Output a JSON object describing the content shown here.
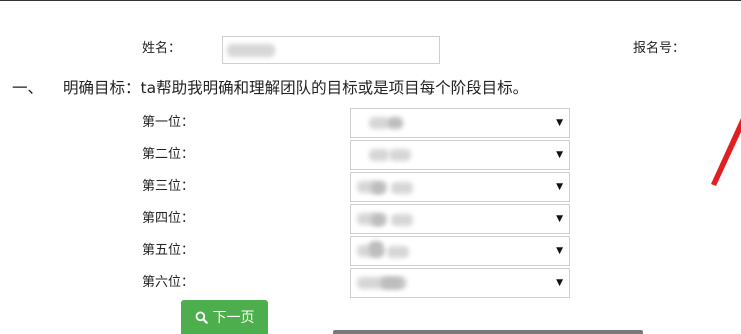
{
  "form": {
    "name_label": "姓名：",
    "reg_label": "报名号：",
    "question_number": "一、",
    "question_text": "明确目标：ta帮助我明确和理解团队的目标或是项目每个阶段目标。"
  },
  "ranks": [
    {
      "label": "第一位："
    },
    {
      "label": "第二位："
    },
    {
      "label": "第三位："
    },
    {
      "label": "第四位："
    },
    {
      "label": "第五位："
    },
    {
      "label": "第六位："
    }
  ],
  "next_button": {
    "label": "下一页",
    "icon": "search-icon"
  },
  "colors": {
    "button_bg": "#4cae4c",
    "annotation_arrow": "#e02020"
  }
}
